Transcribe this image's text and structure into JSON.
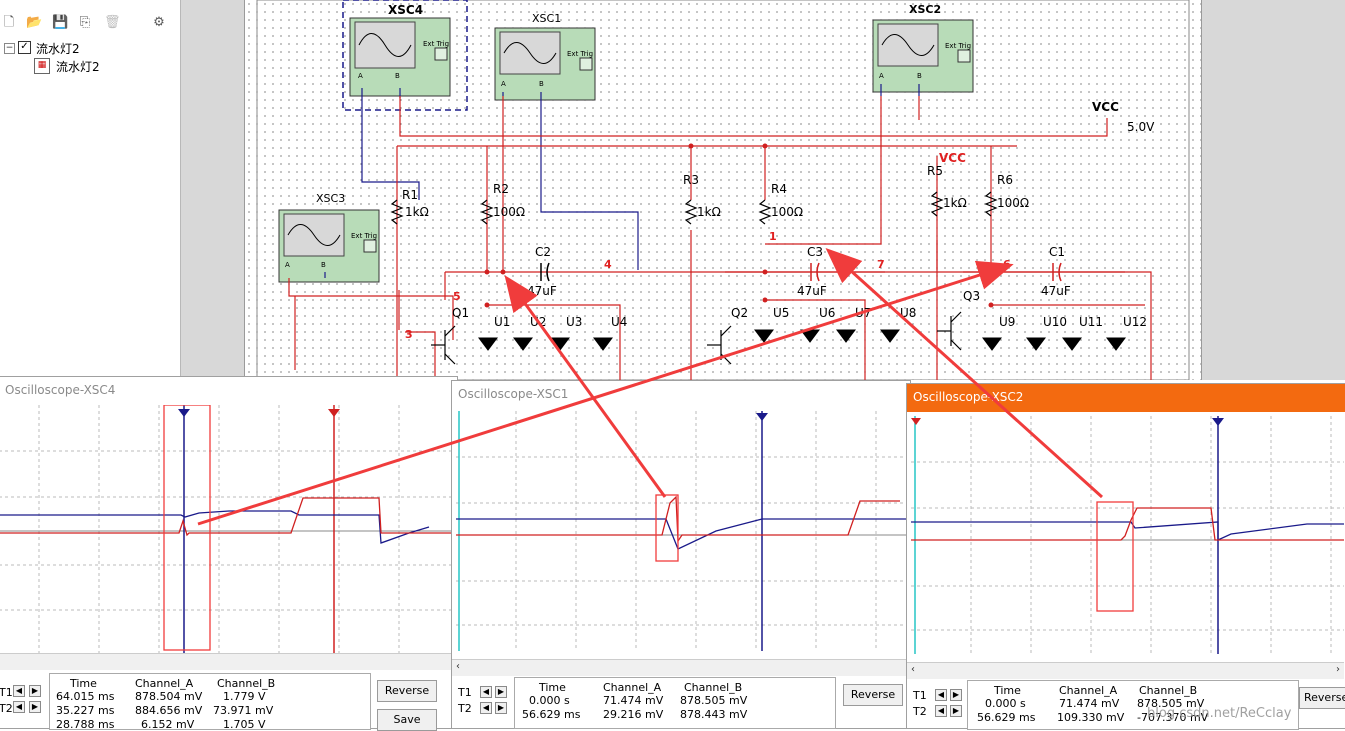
{
  "project_tree": {
    "root": "流水灯2",
    "child": "流水灯2"
  },
  "schematic": {
    "scopes": {
      "xsc4": "XSC4",
      "xsc1": "XSC1",
      "xsc2": "XSC2",
      "xsc3": "XSC3",
      "ext_trig": "Ext Trig",
      "a": "A",
      "b": "B"
    },
    "vcc": {
      "label": "VCC",
      "value": "5.0V",
      "net": "VCC"
    },
    "resistors": [
      {
        "name": "R1",
        "value": "1kΩ"
      },
      {
        "name": "R2",
        "value": "100Ω"
      },
      {
        "name": "R3",
        "value": "1kΩ"
      },
      {
        "name": "R4",
        "value": "100Ω"
      },
      {
        "name": "R5",
        "value": "1kΩ"
      },
      {
        "name": "R6",
        "value": "100Ω"
      }
    ],
    "capacitors": [
      {
        "name": "C2",
        "value": "47uF"
      },
      {
        "name": "C3",
        "value": "47uF"
      },
      {
        "name": "C1",
        "value": "47uF"
      }
    ],
    "transistors": [
      "Q1",
      "Q2",
      "Q3"
    ],
    "leds": [
      "U1",
      "U2",
      "U3",
      "U4",
      "U5",
      "U6",
      "U7",
      "U8",
      "U9",
      "U10",
      "U11",
      "U12"
    ],
    "nets": [
      "5",
      "3",
      "4",
      "1",
      "7",
      "6"
    ]
  },
  "oscilloscopes": [
    {
      "title": "Oscilloscope-XSC4",
      "headers": {
        "time": "Time",
        "a": "Channel_A",
        "b": "Channel_B"
      },
      "rows": [
        {
          "t": "T1",
          "time": "64.015 ms",
          "a": "878.504 mV",
          "b": "1.779 V"
        },
        {
          "t": "T2",
          "time": "35.227 ms",
          "a": "884.656 mV",
          "b": "73.971 mV"
        },
        {
          "t": "",
          "time": "28.788 ms",
          "a": "6.152 mV",
          "b": "1.705 V"
        }
      ],
      "buttons": {
        "reverse": "Reverse",
        "save": "Save"
      }
    },
    {
      "title": "Oscilloscope-XSC1",
      "headers": {
        "time": "Time",
        "a": "Channel_A",
        "b": "Channel_B"
      },
      "rows": [
        {
          "t": "T1",
          "time": "0.000 s",
          "a": "71.474 mV",
          "b": "878.505 mV"
        },
        {
          "t": "T2",
          "time": "56.629 ms",
          "a": "29.216 mV",
          "b": "878.443 mV"
        }
      ],
      "buttons": {
        "reverse": "Reverse"
      }
    },
    {
      "title": "Oscilloscope-XSC2",
      "headers": {
        "time": "Time",
        "a": "Channel_A",
        "b": "Channel_B"
      },
      "rows": [
        {
          "t": "T1",
          "time": "0.000 s",
          "a": "71.474 mV",
          "b": "878.505 mV"
        },
        {
          "t": "T2",
          "time": "56.629 ms",
          "a": "109.330 mV",
          "b": "-707.370 mV"
        }
      ],
      "buttons": {
        "reverse": "Reverse"
      }
    }
  ],
  "watermark": "blog.csdn.net/ReCclay",
  "colors": {
    "accent_title": "#f36a10",
    "trace_a": "#e02020",
    "trace_b": "#1a1a8a",
    "annotation": "#f03c3c"
  }
}
